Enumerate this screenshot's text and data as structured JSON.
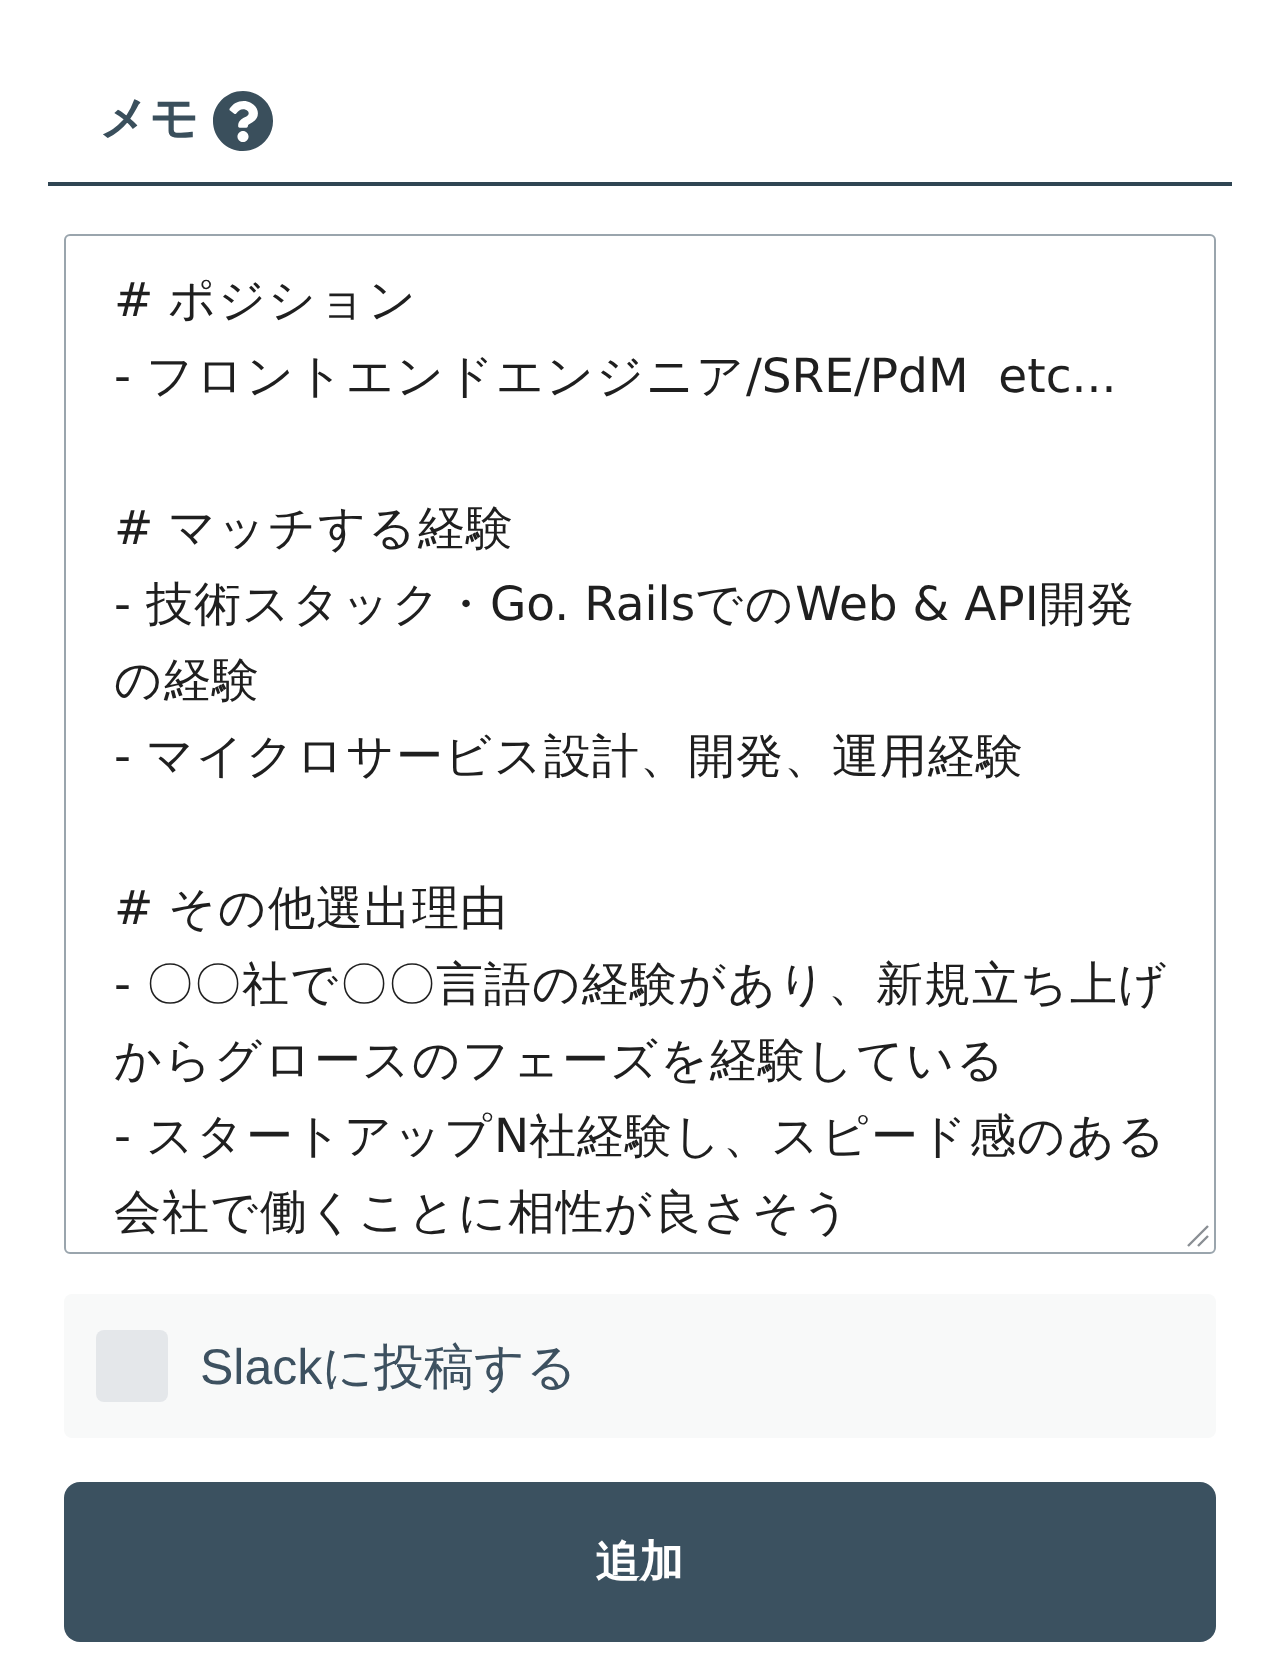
{
  "header": {
    "title": "メモ"
  },
  "memo": {
    "value": "# ポジション\n- フロントエンドエンジニア/SRE/PdM  etc...\n\n# マッチする経験\n- 技術スタック・Go. RailsでのWeb & API開発の経験\n- マイクロサービス設計、開発、運用経験\n\n# その他選出理由\n- 〇〇社で〇〇言語の経験があり、新規立ち上げからグロースのフェーズを経験している\n- スタートアップN社経験し、スピード感のある会社で働くことに相性が良さそう"
  },
  "slack_option": {
    "label": "Slackに投稿する",
    "checked": false
  },
  "buttons": [
    {
      "label": "追加"
    }
  ]
}
